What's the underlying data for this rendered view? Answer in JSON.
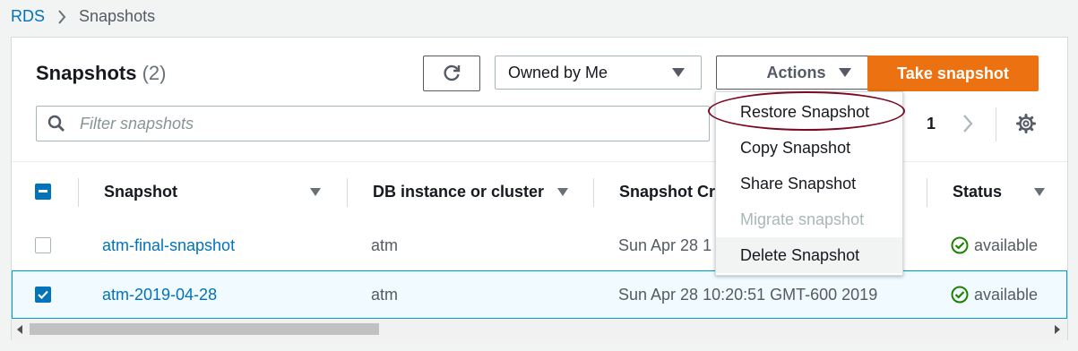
{
  "breadcrumb": {
    "root": "RDS",
    "current": "Snapshots"
  },
  "header": {
    "title": "Snapshots",
    "count": "(2)",
    "owner_filter": "Owned by Me",
    "actions_label": "Actions",
    "take_snapshot_label": "Take snapshot"
  },
  "filter": {
    "placeholder": "Filter snapshots"
  },
  "pagination": {
    "page": "1"
  },
  "table": {
    "columns": [
      "Snapshot",
      "DB instance or cluster",
      "Snapshot Cr",
      "Status"
    ],
    "rows": [
      {
        "snapshot": "atm-final-snapshot",
        "instance": "atm",
        "created": "Sun Apr 28 1",
        "status": "available",
        "selected": false
      },
      {
        "snapshot": "atm-2019-04-28",
        "instance": "atm",
        "created": "Sun Apr 28 10:20:51 GMT-600 2019",
        "status": "available",
        "selected": true
      }
    ]
  },
  "actions_menu": {
    "items": [
      "Restore Snapshot",
      "Copy Snapshot",
      "Share Snapshot",
      "Migrate snapshot",
      "Delete Snapshot"
    ],
    "disabled": [
      "Migrate snapshot"
    ],
    "hovered": "Delete Snapshot",
    "annotated": "Restore Snapshot"
  },
  "colors": {
    "primary": "#ec7211",
    "link": "#0073bb",
    "success": "#1d8102",
    "annotation": "#7a0a22"
  },
  "icons": [
    "refresh-icon",
    "caret-down-icon",
    "search-icon",
    "chevron-right-icon",
    "gear-icon",
    "check-circle-icon",
    "sort-caret-icon"
  ]
}
